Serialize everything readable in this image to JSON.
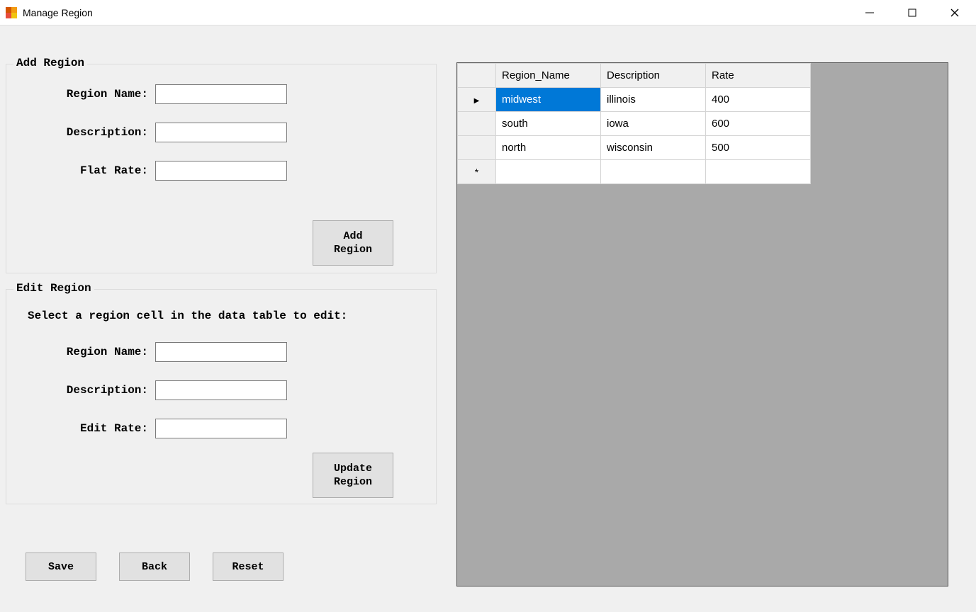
{
  "window": {
    "title": "Manage Region"
  },
  "addRegion": {
    "title": "Add Region",
    "labels": {
      "name": "Region Name:",
      "description": "Description:",
      "rate": "Flat Rate:"
    },
    "values": {
      "name": "",
      "description": "",
      "rate": ""
    },
    "button": "Add\nRegion"
  },
  "editRegion": {
    "title": "Edit Region",
    "instruction": "Select a region cell in the data table to edit:",
    "labels": {
      "name": "Region Name:",
      "description": "Description:",
      "rate": "Edit Rate:"
    },
    "values": {
      "name": "",
      "description": "",
      "rate": ""
    },
    "button": "Update\nRegion"
  },
  "bottomButtons": {
    "save": "Save",
    "back": "Back",
    "reset": "Reset"
  },
  "grid": {
    "headers": {
      "name": "Region_Name",
      "description": "Description",
      "rate": "Rate"
    },
    "rows": [
      {
        "name": "midwest",
        "description": "illinois",
        "rate": "400",
        "current": true,
        "selectedCell": "name"
      },
      {
        "name": "south",
        "description": "iowa",
        "rate": "600",
        "current": false
      },
      {
        "name": "north",
        "description": "wisconsin",
        "rate": "500",
        "current": false
      }
    ]
  }
}
